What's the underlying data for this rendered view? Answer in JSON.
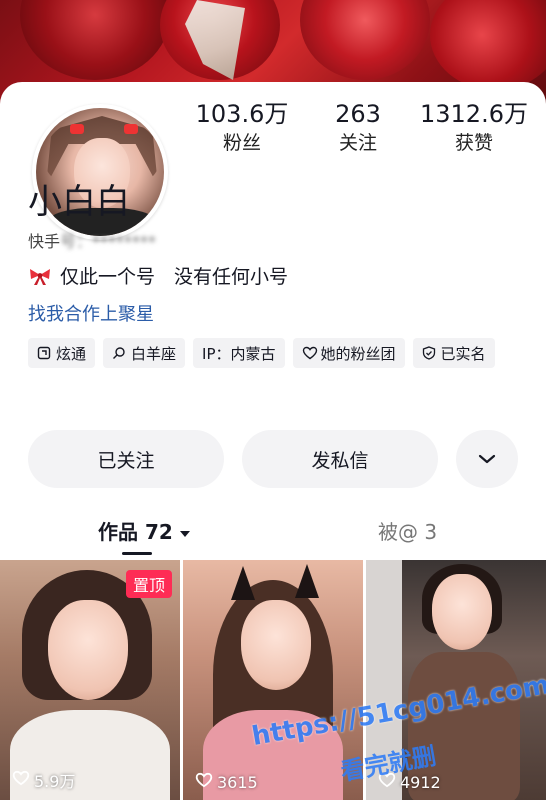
{
  "profile": {
    "nickname": "小白白",
    "account_prefix": "快手",
    "account_blurred": "号：********",
    "bio": "仅此一个号　没有任何小号",
    "cooperation_link": "找我合作上聚星"
  },
  "stats": [
    {
      "value": "103.6万",
      "label": "粉丝"
    },
    {
      "value": "263",
      "label": "关注"
    },
    {
      "value": "1312.6万",
      "label": "获赞"
    }
  ],
  "tags": [
    {
      "icon": "xuantong-icon",
      "label": "炫通"
    },
    {
      "icon": "search-icon",
      "label": "白羊座"
    },
    {
      "icon": "",
      "label": "IP：内蒙古"
    },
    {
      "icon": "heart-outline-icon",
      "label": "她的粉丝团"
    },
    {
      "icon": "shield-check-icon",
      "label": "已实名"
    }
  ],
  "actions": {
    "follow_label": "已关注",
    "message_label": "发私信"
  },
  "tabs": {
    "works_label": "作品 72",
    "mention_label": "被@ 3"
  },
  "videos": [
    {
      "pinned_label": "置顶",
      "likes": "5.9万"
    },
    {
      "likes": "3615"
    },
    {
      "likes": "4912"
    }
  ],
  "watermark": {
    "url": "https://51cg014.com",
    "sub": "看完就删"
  },
  "colors": {
    "accent_red": "#fe2c55",
    "link_blue": "#2b5ca8",
    "button_bg": "#f3f3f5"
  }
}
